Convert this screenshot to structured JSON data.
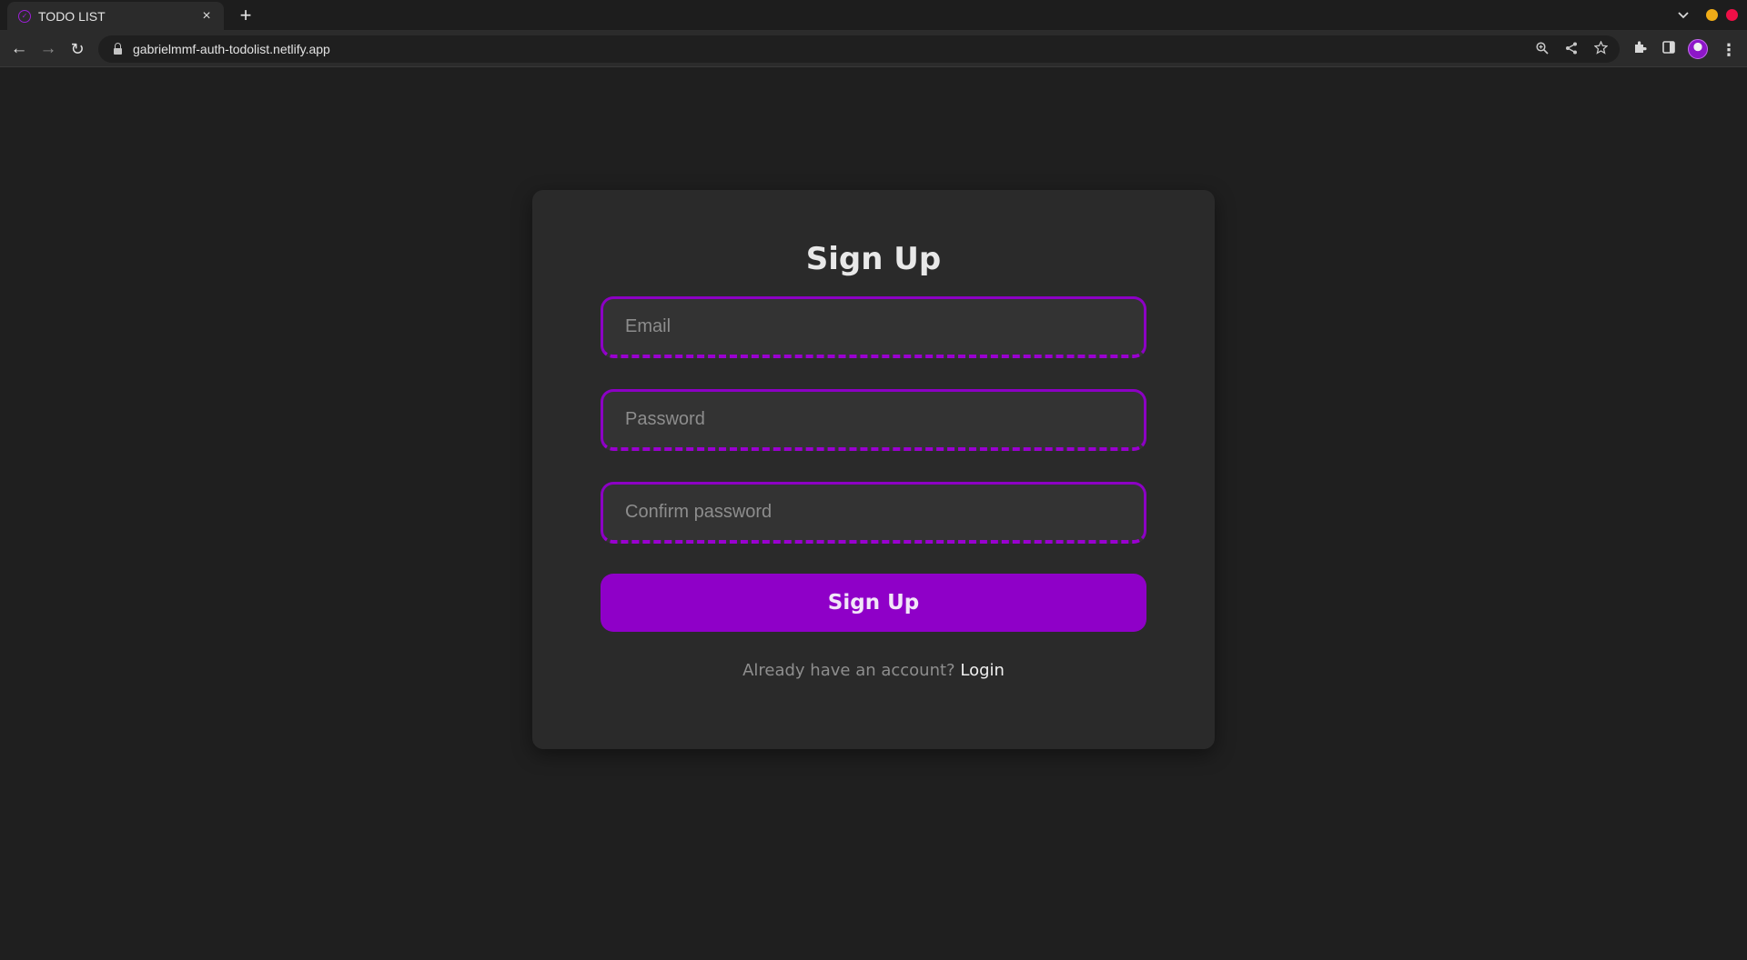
{
  "browser": {
    "tab": {
      "title": "TODO LIST",
      "favicon": "check-circle-icon",
      "close": "×"
    },
    "new_tab": "+",
    "tab_search": "⌄",
    "nav": {
      "back": "←",
      "forward": "→",
      "reload": "↻"
    },
    "url": "gabrielmmf-auth-todolist.netlify.app",
    "toolbar_icons": [
      "zoom-icon",
      "share-icon",
      "star-icon",
      "extensions-icon",
      "side-panel-icon",
      "profile-avatar",
      "menu-icon"
    ]
  },
  "page": {
    "title": "Sign Up",
    "email_placeholder": "Email",
    "password_placeholder": "Password",
    "confirm_placeholder": "Confirm password",
    "submit_label": "Sign Up",
    "footer_text": "Already have an account?",
    "login_link": "Login"
  },
  "colors": {
    "accent": "#8f00c8",
    "background": "#1f1f1f",
    "card": "#2a2a2a"
  }
}
